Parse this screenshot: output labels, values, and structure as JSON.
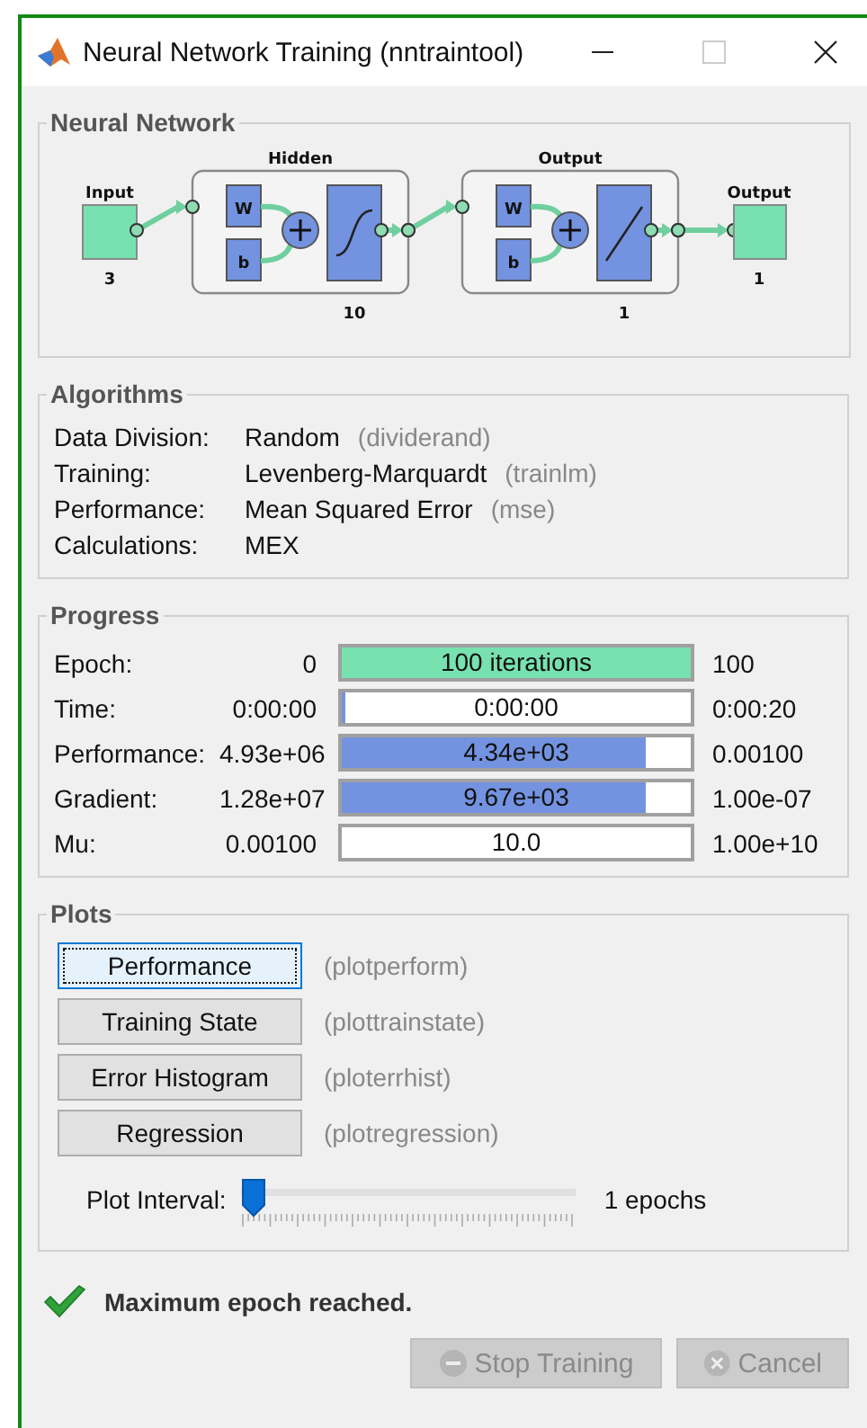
{
  "window": {
    "title": "Neural Network Training (nntraintool)"
  },
  "network": {
    "title": "Neural Network",
    "input": {
      "label": "Input",
      "size": "3"
    },
    "layers": [
      {
        "name": "Hidden",
        "size": "10",
        "weight": "W",
        "bias": "b",
        "kind": "sigmoid"
      },
      {
        "name": "Output",
        "size": "1",
        "weight": "W",
        "bias": "b",
        "kind": "linear"
      }
    ],
    "output": {
      "label": "Output",
      "size": "1"
    }
  },
  "algorithms": {
    "title": "Algorithms",
    "rows": [
      {
        "label": "Data Division:",
        "value": "Random",
        "function": "(dividerand)"
      },
      {
        "label": "Training:",
        "value": "Levenberg-Marquardt",
        "function": "(trainlm)"
      },
      {
        "label": "Performance:",
        "value": "Mean Squared Error",
        "function": "(mse)"
      },
      {
        "label": "Calculations:",
        "value": "MEX"
      }
    ]
  },
  "progress": {
    "title": "Progress",
    "rows": [
      {
        "label": "Epoch:",
        "start": "0",
        "current": "100 iterations",
        "end": "100",
        "level": 1,
        "color": "#77e2b0"
      },
      {
        "label": "Time:",
        "start": "0:00:00",
        "current": "0:00:00",
        "end": "0:00:20",
        "level": 0.01,
        "color": "#7393e0"
      },
      {
        "label": "Performance:",
        "start": "4.93e+06",
        "current": "4.34e+03",
        "end": "0.00100",
        "level": 0.87,
        "color": "#7393e0"
      },
      {
        "label": "Gradient:",
        "start": "1.28e+07",
        "current": "9.67e+03",
        "end": "1.00e-07",
        "level": 0.87,
        "color": "#7393e0"
      },
      {
        "label": "Mu:",
        "start": "0.00100",
        "current": "10.0",
        "end": "1.00e+10"
      }
    ]
  },
  "plots": {
    "title": "Plots",
    "buttons": [
      {
        "label": "Performance",
        "function": "(plotperform)",
        "selected": true
      },
      {
        "label": "Training State",
        "function": "(plottrainstate)",
        "selected": false
      },
      {
        "label": "Error Histogram",
        "function": "(ploterrhist)",
        "selected": false
      },
      {
        "label": "Regression",
        "function": "(plotregression)",
        "selected": false
      }
    ],
    "interval": {
      "label": "Plot Interval:",
      "level": 0,
      "value": "1 epochs"
    }
  },
  "status": {
    "text": "Maximum epoch reached."
  },
  "buttons": [
    {
      "label": "Stop Training",
      "kind": "stop",
      "disabled": true
    },
    {
      "label": "Cancel",
      "kind": "cancel",
      "disabled": true
    }
  ]
}
